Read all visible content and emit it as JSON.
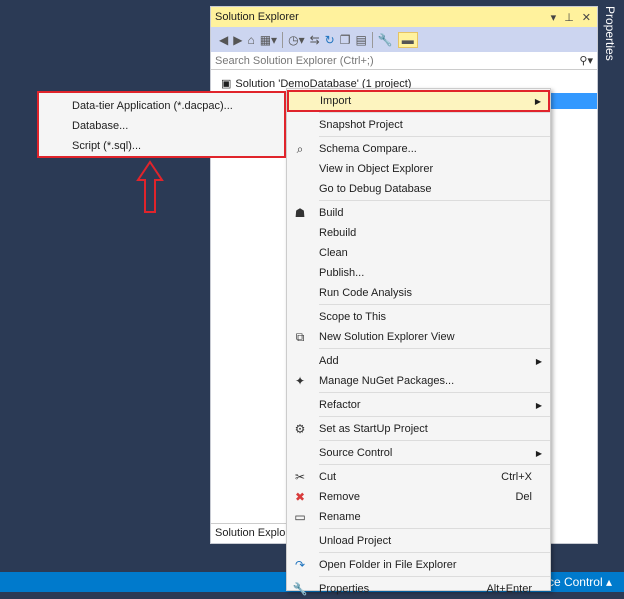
{
  "solution_explorer": {
    "title": "Solution Explorer",
    "search_placeholder": "Search Solution Explorer (Ctrl+;)",
    "tree_item": "Solution 'DemoDatabase' (1 project)",
    "bottom_tab": "Solution Explo"
  },
  "side_panel": {
    "label": "Properties"
  },
  "status_bar": {
    "text": "ce Control ▴"
  },
  "context_menu": [
    {
      "label": "Import",
      "submenu": true,
      "highlighted": true,
      "sep_after": true
    },
    {
      "label": "Snapshot Project",
      "sep_after": true
    },
    {
      "label": "Schema Compare...",
      "icon": "schema-compare-icon",
      "glyph": "⌕"
    },
    {
      "label": "View in Object Explorer"
    },
    {
      "label": "Go to Debug Database",
      "sep_after": true
    },
    {
      "label": "Build",
      "icon": "build-icon",
      "glyph": "☗"
    },
    {
      "label": "Rebuild"
    },
    {
      "label": "Clean"
    },
    {
      "label": "Publish..."
    },
    {
      "label": "Run Code Analysis",
      "sep_after": true
    },
    {
      "label": "Scope to This"
    },
    {
      "label": "New Solution Explorer View",
      "icon": "new-view-icon",
      "glyph": "⧉",
      "sep_after": true
    },
    {
      "label": "Add",
      "submenu": true
    },
    {
      "label": "Manage NuGet Packages...",
      "icon": "nuget-icon",
      "glyph": "✦",
      "sep_after": true
    },
    {
      "label": "Refactor",
      "submenu": true,
      "sep_after": true
    },
    {
      "label": "Set as StartUp Project",
      "icon": "gear-icon",
      "glyph": "⚙",
      "sep_after": true
    },
    {
      "label": "Source Control",
      "submenu": true,
      "sep_after": true
    },
    {
      "label": "Cut",
      "icon": "scissors-icon",
      "glyph": "✂",
      "shortcut": "Ctrl+X"
    },
    {
      "label": "Remove",
      "icon": "remove-icon",
      "glyph": "✖",
      "shortcut": "Del",
      "color": "#d83b3b"
    },
    {
      "label": "Rename",
      "icon": "rename-icon",
      "glyph": "▭",
      "sep_after": true
    },
    {
      "label": "Unload Project",
      "sep_after": true
    },
    {
      "label": "Open Folder in File Explorer",
      "icon": "open-folder-icon",
      "glyph": "↷",
      "color": "#1e73be",
      "sep_after": true
    },
    {
      "label": "Properties",
      "icon": "wrench-icon",
      "glyph": "🔧",
      "shortcut": "Alt+Enter"
    }
  ],
  "import_submenu": [
    "Data-tier Application (*.dacpac)...",
    "Database...",
    "Script (*.sql)..."
  ]
}
